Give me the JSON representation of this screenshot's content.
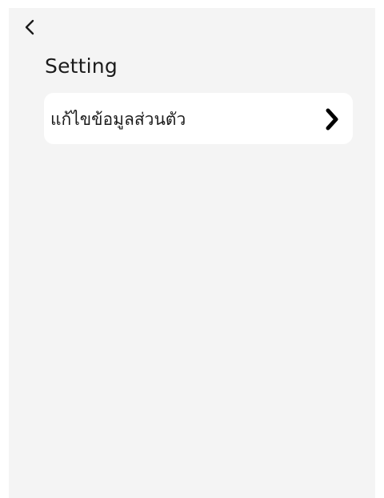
{
  "header": {
    "back_icon": "chevron-left-icon"
  },
  "page": {
    "title": "Setting"
  },
  "menu": {
    "items": [
      {
        "label": "แก้ไขข้อมูลส่วนตัว",
        "icon": "chevron-right-icon"
      }
    ]
  },
  "colors": {
    "page_background": "#f4f4f4",
    "card_background": "#ffffff",
    "text": "#1b1b1b"
  }
}
